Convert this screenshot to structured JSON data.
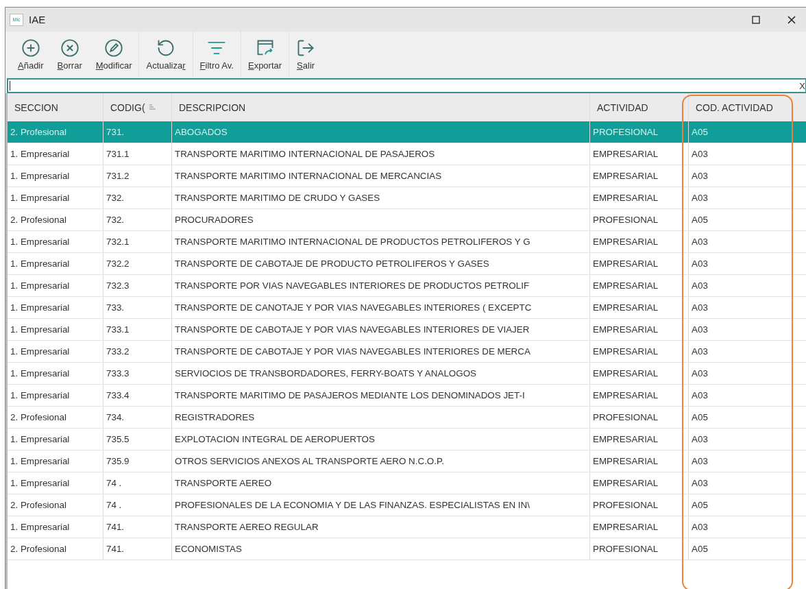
{
  "window": {
    "app_badge": "Mic",
    "title": "IAE"
  },
  "toolbar": [
    {
      "key": "A",
      "after": "ñadir",
      "group_end": false
    },
    {
      "key": "B",
      "after": "orrar",
      "group_end": false
    },
    {
      "key": "M",
      "after": "odificar",
      "group_end": true
    },
    {
      "before": "Actualiza",
      "key": "r",
      "group_end": true
    },
    {
      "key": "F",
      "after": "iltro Av.",
      "group_end": true
    },
    {
      "key": "E",
      "after": "xportar",
      "group_end": true
    },
    {
      "key": "S",
      "after": "alir",
      "group_end": false
    }
  ],
  "search": {
    "clear": "X"
  },
  "table": {
    "columns": [
      {
        "label": "SECCION",
        "sorted": false,
        "highlighted": false
      },
      {
        "label": "CODIG(",
        "sorted": true,
        "highlighted": false
      },
      {
        "label": "DESCRIPCION",
        "sorted": false,
        "highlighted": false
      },
      {
        "label": "ACTIVIDAD",
        "sorted": false,
        "highlighted": false
      },
      {
        "label": "COD. ACTIVIDAD",
        "sorted": false,
        "highlighted": true
      }
    ],
    "rows": [
      {
        "selected": true,
        "cells": [
          "2. Profesional",
          "731.",
          "ABOGADOS",
          "PROFESIONAL",
          "A05"
        ]
      },
      {
        "selected": false,
        "cells": [
          "1. Empresarial",
          "731.1",
          "TRANSPORTE MARITIMO INTERNACIONAL DE PASAJEROS",
          "EMPRESARIAL",
          "A03"
        ]
      },
      {
        "selected": false,
        "cells": [
          "1. Empresarial",
          "731.2",
          "TRANSPORTE MARITIMO INTERNACIONAL DE MERCANCIAS",
          "EMPRESARIAL",
          "A03"
        ]
      },
      {
        "selected": false,
        "cells": [
          "1. Empresarial",
          "732.",
          "TRANSPORTE MARITIMO DE CRUDO Y GASES",
          "EMPRESARIAL",
          "A03"
        ]
      },
      {
        "selected": false,
        "cells": [
          "2. Profesional",
          "732.",
          "PROCURADORES",
          "PROFESIONAL",
          "A05"
        ]
      },
      {
        "selected": false,
        "cells": [
          "1. Empresarial",
          "732.1",
          "TRANSPORTE MARITIMO INTERNACIONAL DE PRODUCTOS PETROLIFEROS Y G",
          "EMPRESARIAL",
          "A03"
        ]
      },
      {
        "selected": false,
        "cells": [
          "1. Empresarial",
          "732.2",
          "TRANSPORTE DE CABOTAJE DE PRODUCTO PETROLIFEROS Y GASES",
          "EMPRESARIAL",
          "A03"
        ]
      },
      {
        "selected": false,
        "cells": [
          "1. Empresarial",
          "732.3",
          "TRANSPORTE POR VIAS NAVEGABLES INTERIORES DE PRODUCTOS PETROLIF",
          "EMPRESARIAL",
          "A03"
        ]
      },
      {
        "selected": false,
        "cells": [
          "1. Empresarial",
          "733.",
          "TRANSPORTE DE CANOTAJE Y POR VIAS NAVEGABLES INTERIORES ( EXCEPTC",
          "EMPRESARIAL",
          "A03"
        ]
      },
      {
        "selected": false,
        "cells": [
          "1. Empresarial",
          "733.1",
          "TRANSPORTE DE CABOTAJE Y POR VIAS NAVEGABLES INTERIORES DE VIAJER",
          "EMPRESARIAL",
          "A03"
        ]
      },
      {
        "selected": false,
        "cells": [
          "1. Empresarial",
          "733.2",
          "TRANSPORTE DE CABOTAJE Y POR VIAS NAVEGABLES INTERIORES DE MERCA",
          "EMPRESARIAL",
          "A03"
        ]
      },
      {
        "selected": false,
        "cells": [
          "1. Empresarial",
          "733.3",
          "SERVIOCIOS DE TRANSBORDADORES, FERRY-BOATS Y ANALOGOS",
          "EMPRESARIAL",
          "A03"
        ]
      },
      {
        "selected": false,
        "cells": [
          "1. Empresarial",
          "733.4",
          "TRANSPORTE MARITIMO DE PASAJEROS MEDIANTE LOS DENOMINADOS JET-I",
          "EMPRESARIAL",
          "A03"
        ]
      },
      {
        "selected": false,
        "cells": [
          "2. Profesional",
          "734.",
          "REGISTRADORES",
          "PROFESIONAL",
          "A05"
        ]
      },
      {
        "selected": false,
        "cells": [
          "1. Empresarial",
          "735.5",
          "EXPLOTACION INTEGRAL DE AEROPUERTOS",
          "EMPRESARIAL",
          "A03"
        ]
      },
      {
        "selected": false,
        "cells": [
          "1. Empresarial",
          "735.9",
          "OTROS SERVICIOS ANEXOS AL TRANSPORTE AERO N.C.O.P.",
          "EMPRESARIAL",
          "A03"
        ]
      },
      {
        "selected": false,
        "cells": [
          "1. Empresarial",
          "74 .",
          "TRANSPORTE AEREO",
          "EMPRESARIAL",
          "A03"
        ]
      },
      {
        "selected": false,
        "cells": [
          "2. Profesional",
          "74 .",
          "PROFESIONALES DE LA ECONOMIA Y DE LAS FINANZAS. ESPECIALISTAS EN IN\\",
          "PROFESIONAL",
          "A05"
        ]
      },
      {
        "selected": false,
        "cells": [
          "1. Empresarial",
          "741.",
          "TRANSPORTE AEREO REGULAR",
          "EMPRESARIAL",
          "A03"
        ]
      },
      {
        "selected": false,
        "cells": [
          "2. Profesional",
          "741.",
          "ECONOMISTAS",
          "PROFESIONAL",
          "A05"
        ]
      }
    ]
  }
}
